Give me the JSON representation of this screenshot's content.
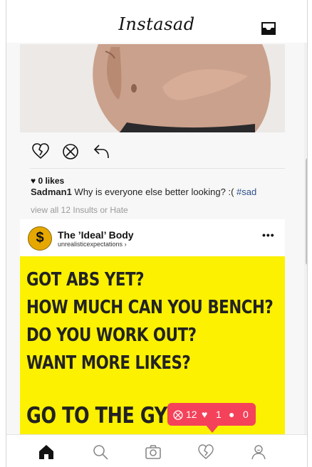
{
  "app": {
    "title": "Instasad"
  },
  "post1": {
    "likes_label": "0 likes",
    "username": "Sadman1",
    "caption": " Why is everyone else better looking? :( ",
    "hashtag": "#sad",
    "view_all": "view all 12 Insults or Hate"
  },
  "post2": {
    "account_name": "The ’Ideal’ Body",
    "account_handle": "unrealisticexpectations",
    "more_label": "•••",
    "avatar_symbol": "$",
    "promo_lines": [
      "GOT ABS YET?",
      "HOW MUCH CAN YOU BENCH?",
      "DO YOU WORK OUT?",
      "WANT MORE LIKES?",
      "GO TO THE GYM."
    ],
    "promo_bg": "#fbf100"
  },
  "notification": {
    "insults": "12",
    "hearts": "1",
    "followers": "0",
    "color": "#f4425a"
  },
  "nav": [
    "home-icon",
    "search-icon",
    "camera-icon",
    "broken-heart-icon",
    "profile-icon"
  ]
}
